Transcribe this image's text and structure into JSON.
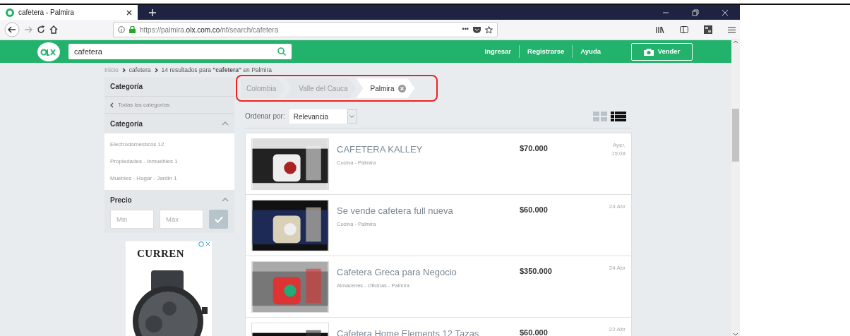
{
  "browser": {
    "tab": {
      "title": "cafetera - Palmira",
      "selected": true
    },
    "url": "https://palmira.**olx.com.co**/nf/search/cafetera",
    "menu_dots": "•••"
  },
  "header": {
    "search_value": "cafetera",
    "links": [
      "Ingresar",
      "Registrarse",
      "Ayuda"
    ],
    "sell_button": "Vender"
  },
  "breadcrumb": [
    "Inicio",
    "cafetera",
    "14 resultados para **\"cafetera\"** en Palmira"
  ],
  "sidebar": {
    "title": "Categoría",
    "all_categories": "Todas las categorías",
    "category": {
      "title": "Categoría",
      "expanded": true,
      "items": [
        "Electrodomésticos 12",
        "Propiedades - Inmuebles 1",
        "Muebles - Hogar - Jardin 1"
      ]
    },
    "price": {
      "title": "Precio",
      "expanded": true,
      "min_placeholder": "Min",
      "max_placeholder": "Max"
    },
    "ad": {
      "brand": "CURREN",
      "kind": "picture"
    }
  },
  "location_filter": [
    {
      "label": "Colombia",
      "selected": false
    },
    {
      "label": "Valle del Cauca",
      "selected": false
    },
    {
      "label": "Palmira",
      "selected": true
    }
  ],
  "sort": {
    "label": "Ordenar por:",
    "value": "Relevancia"
  },
  "view_toggles": [
    {
      "kind": "grid",
      "selected": false
    },
    {
      "kind": "list",
      "selected": true
    }
  ],
  "listings": [
    {
      "title": "CAFETERA KALLEY",
      "location": "Cocina - Palmira",
      "price": "$70.000",
      "date": "Ayer, 15:08",
      "kind": "picture"
    },
    {
      "title": "Se vende cafetera full nueva",
      "location": "Cocina - Palmira",
      "price": "$60.000",
      "date": "24 Abr",
      "kind": "picture"
    },
    {
      "title": "Cafetera Greca para Negocio",
      "location": "Almacenes - Oficinas - Palmira",
      "price": "$350.000",
      "date": "24 Abr",
      "kind": "picture"
    },
    {
      "title": "Cafetera Home Elements 12 Tazas",
      "price": "$60.000",
      "date": "22 Abr",
      "kind": "picture"
    }
  ]
}
